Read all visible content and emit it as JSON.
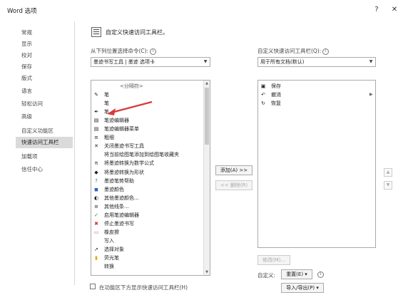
{
  "window": {
    "title": "Word 选项",
    "help": "?",
    "close": "✕"
  },
  "nav": {
    "items": [
      "常规",
      "显示",
      "校对",
      "保存",
      "版式",
      "语言",
      "轻松访问",
      "高级",
      "自定义功能区",
      "快速访问工具栏",
      "加载项",
      "信任中心"
    ],
    "active_index": 9
  },
  "header": {
    "text": "自定义快速访问工具栏。"
  },
  "left": {
    "choose_label": "从下列位置选择命令(C):",
    "choose_value": "墨迹书写工具 | 墨迹 选项卡",
    "commands": [
      {
        "label": "<分隔符>",
        "icon": "",
        "sep": true
      },
      {
        "label": "笔",
        "icon": "pen-cup-icon",
        "arrow": true
      },
      {
        "label": "笔",
        "icon": "",
        "btn": true
      },
      {
        "label": "笔",
        "icon": "pen-icon"
      },
      {
        "label": "笔迹编辑器",
        "icon": "editor-icon"
      },
      {
        "label": "笔迹编辑器菜单",
        "icon": "editor-menu-icon",
        "arrow": true
      },
      {
        "label": "粗细",
        "icon": "thickness-icon",
        "arrow": true
      },
      {
        "label": "关闭墨迹书写工具",
        "icon": "close-ink-icon",
        "btn": true
      },
      {
        "label": "将当前绘图笔添加到绘图笔收藏夹",
        "icon": ""
      },
      {
        "label": "将墨迹转换为数学公式",
        "icon": "math-icon"
      },
      {
        "label": "将墨迹转换为形状",
        "icon": "shape-icon"
      },
      {
        "label": "墨迹笔势帮助",
        "icon": "help-icon"
      },
      {
        "label": "墨迹颜色",
        "icon": "color-icon",
        "arrow": true
      },
      {
        "label": "其他墨迹颜色...",
        "icon": "palette-icon"
      },
      {
        "label": "其他线条...",
        "icon": "lines-icon"
      },
      {
        "label": "启用笔迹编辑器",
        "icon": "check-icon"
      },
      {
        "label": "停止墨迹书写",
        "icon": "stop-icon"
      },
      {
        "label": "橡皮擦",
        "icon": "eraser-icon"
      },
      {
        "label": "写入",
        "icon": "",
        "btn": true
      },
      {
        "label": "选择对象",
        "icon": "cursor-icon"
      },
      {
        "label": "荧光笔",
        "icon": "highlighter-icon"
      },
      {
        "label": "转换",
        "icon": "",
        "btn": true
      }
    ],
    "show_below_label": "在功能区下方显示快速访问工具栏(H)"
  },
  "middle": {
    "add_label": "添加(A) >>",
    "remove_label": "<< 删除(R)"
  },
  "right": {
    "customize_label": "自定义快速访问工具栏(Q):",
    "customize_value": "用于所有文档(默认)",
    "items": [
      {
        "label": "保存",
        "icon": "save-icon"
      },
      {
        "label": "撤消",
        "icon": "undo-icon",
        "arrow": true
      },
      {
        "label": "恢复",
        "icon": "redo-icon"
      }
    ],
    "modify_label": "修改(M)...",
    "custom_label": "自定义:",
    "reset_label": "重置(E) ▾",
    "import_export_label": "导入/导出(P) ▾",
    "move_up": "▲",
    "move_down": "▼"
  },
  "colors": {
    "accent": "#d93a3a",
    "nav_active": "#dadada"
  }
}
